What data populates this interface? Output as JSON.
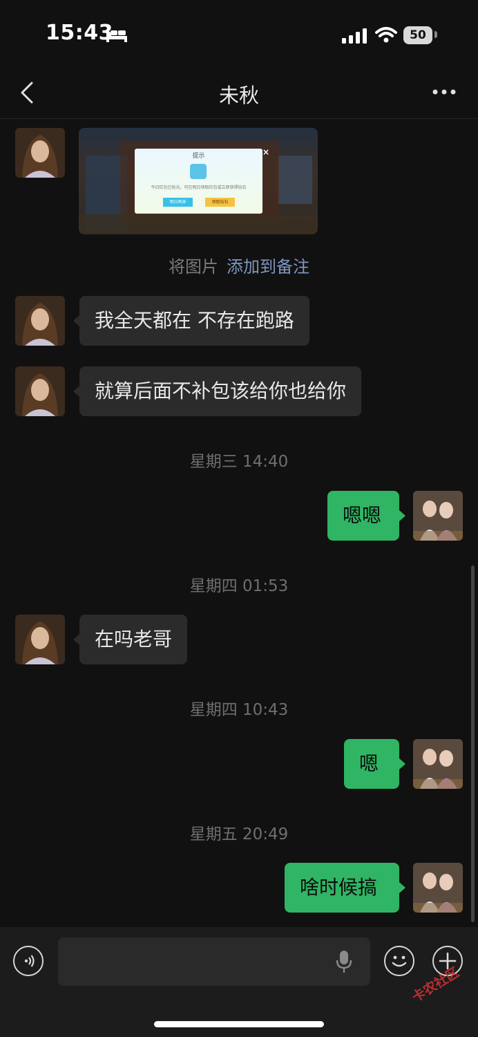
{
  "status_bar": {
    "time": "15:43",
    "battery": "50"
  },
  "header": {
    "title": "未秋"
  },
  "image_message": {
    "dialog_title": "提示",
    "dialog_text": "今日红包已抢光，可在明日领取红包或立即获得钻石",
    "dialog_left_btn": "明日再来",
    "dialog_right_btn": "领取钻石"
  },
  "hint": {
    "prefix": "将图片",
    "action": "添加到备注"
  },
  "messages": [
    {
      "text": "我全天都在 不存在跑路"
    },
    {
      "text": "就算后面不补包该给你也给你"
    },
    {
      "timestamp": "星期三 14:40"
    },
    {
      "text": "嗯嗯"
    },
    {
      "timestamp": "星期四 01:53"
    },
    {
      "text": "在吗老哥"
    },
    {
      "timestamp": "星期四 10:43"
    },
    {
      "text": "嗯"
    },
    {
      "timestamp": "星期五 20:49"
    },
    {
      "text": "啥时候搞"
    }
  ],
  "watermark": "卡农社区",
  "colors": {
    "outgoing_bubble": "#2fb564",
    "incoming_bubble": "#2b2b2b",
    "link": "#7d97c2"
  }
}
